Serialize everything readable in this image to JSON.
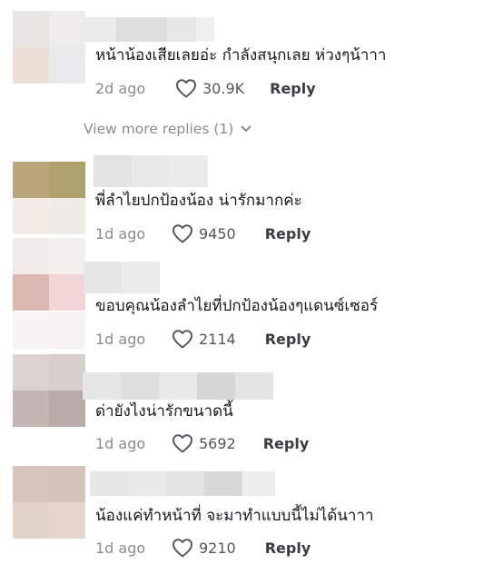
{
  "view_more": {
    "label": "View more replies (1)"
  },
  "comments": [
    {
      "text": "หน้าน้องเสียเลยอ่ะ กำลังสนุกเลย ห่วงๆน้าาา",
      "date": "2d ago",
      "likes": "30.9K",
      "reply_label": "Reply"
    },
    {
      "text": "พี่ลำไยปกป้องน้อง น่ารักมากค่ะ",
      "date": "1d ago",
      "likes": "9450",
      "reply_label": "Reply"
    },
    {
      "text": "ขอบคุณน้องลำไยที่ปกป้องน้องๆแดนซ์เซอร์",
      "date": "1d ago",
      "likes": "2114",
      "reply_label": "Reply"
    },
    {
      "text": "ด่ายังไงน่ารักขนาดนี้",
      "date": "1d ago",
      "likes": "5692",
      "reply_label": "Reply"
    },
    {
      "text": "น้องแค่ทำหน้าที่ จะมาทำแบบนี้ไม่ได้นาาา",
      "date": "1d ago",
      "likes": "9210",
      "reply_label": "Reply"
    }
  ]
}
